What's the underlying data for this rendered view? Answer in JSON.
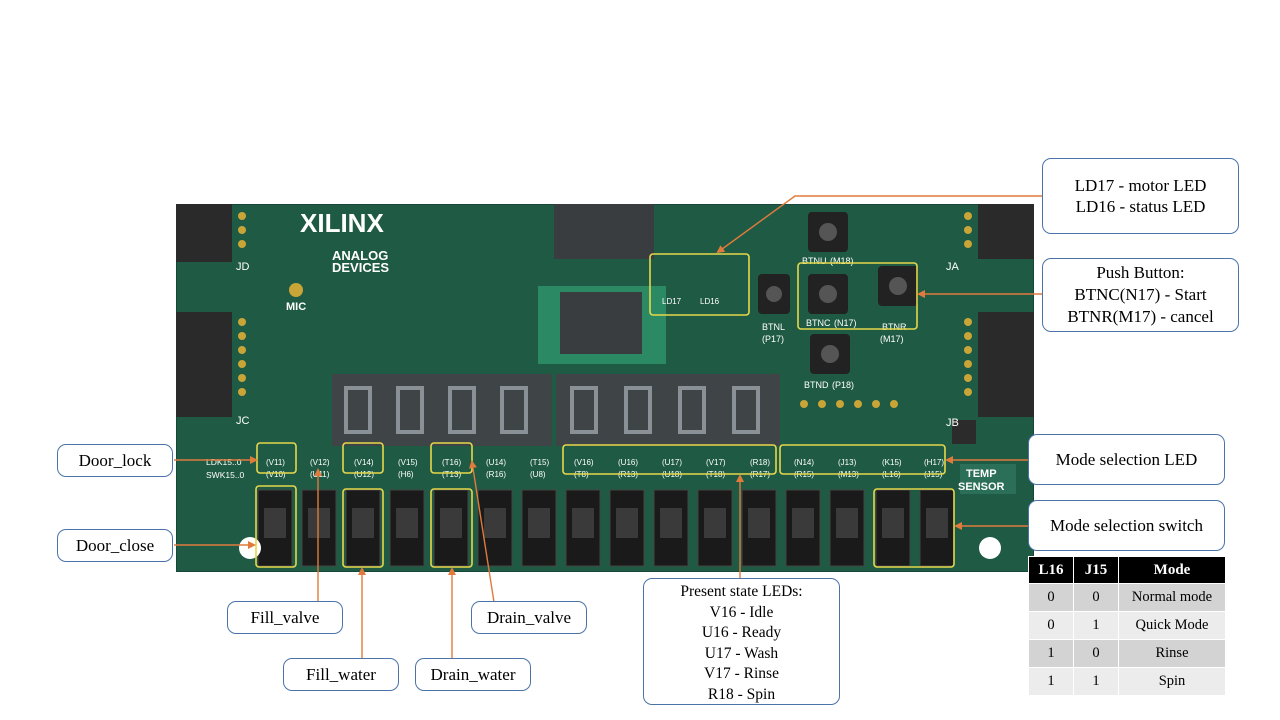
{
  "board": {
    "brand": "XILINX",
    "vendor_line1": "ANALOG",
    "vendor_line2": "DEVICES",
    "mic": "MIC",
    "temp_line1": "TEMP",
    "temp_line2": "SENSOR",
    "ldk_label": "LDK15..0",
    "swk_label": "SWK15..0",
    "connectors": [
      "JD",
      "JC",
      "JA",
      "JB"
    ],
    "buttons": [
      "BTNU",
      "BTNL",
      "BTNC",
      "BTNR",
      "BTND"
    ],
    "button_pins": [
      "(M18)",
      "(P17)",
      "(N17)",
      "(M17)",
      "(P18)"
    ],
    "led_pins": [
      "(V11)",
      "(V12)",
      "(V14)",
      "(V15)",
      "(T16)",
      "(U14)",
      "(T15)",
      "(V16)",
      "(U16)",
      "(U17)",
      "(V17)",
      "(R18)",
      "(N14)",
      "(J13)",
      "(K15)",
      "(H17)"
    ],
    "switch_pins": [
      "(V10)",
      "(U11)",
      "(U12)",
      "(H6)",
      "(T13)",
      "(R16)",
      "(U8)",
      "(T8)",
      "(R13)",
      "(U18)",
      "(T18)",
      "(R17)",
      "(R15)",
      "(M13)",
      "(L16)",
      "(J15)"
    ],
    "ld16": "LD16",
    "ld17": "LD17"
  },
  "callouts": {
    "door_lock": "Door_lock",
    "door_close": "Door_close",
    "fill_valve": "Fill_valve",
    "fill_water": "Fill_water",
    "drain_water": "Drain_water",
    "drain_valve": "Drain_valve",
    "mode_led": "Mode selection LED",
    "mode_switch": "Mode selection switch",
    "led_info": [
      "LD17  -  motor LED",
      "LD16  -  status LED"
    ],
    "push_button": [
      "Push Button:",
      "BTNC(N17)  -  Start",
      "BTNR(M17)  -  cancel"
    ],
    "present_state": [
      "Present state LEDs:",
      "V16  -  Idle",
      "U16  -  Ready",
      "U17  -  Wash",
      "V17  -  Rinse",
      "R18  -  Spin"
    ]
  },
  "mode_table": {
    "headers": [
      "L16",
      "J15",
      "Mode"
    ],
    "rows": [
      [
        "0",
        "0",
        "Normal mode"
      ],
      [
        "0",
        "1",
        "Quick Mode"
      ],
      [
        "1",
        "0",
        "Rinse"
      ],
      [
        "1",
        "1",
        "Spin"
      ]
    ]
  },
  "colors": {
    "board": "#1f5a45",
    "highlight": "#e6d84a",
    "arrow": "#e07b3c",
    "callout_border": "#4a74a8"
  }
}
